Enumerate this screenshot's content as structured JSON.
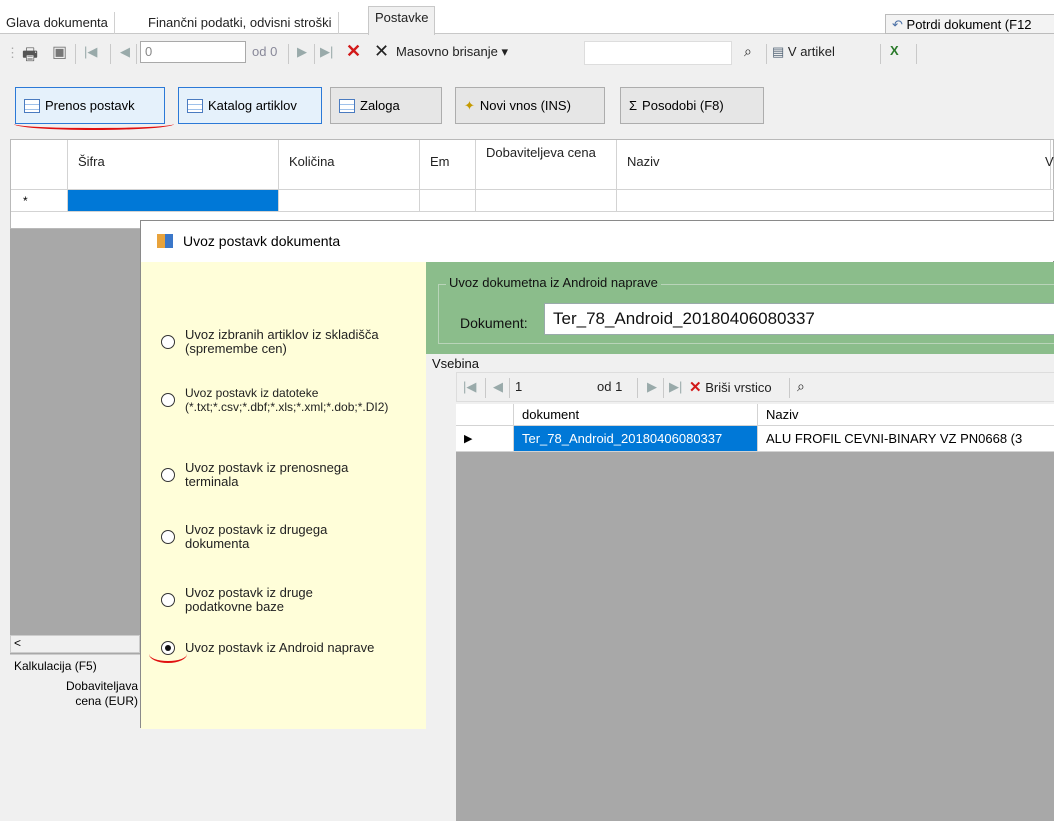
{
  "tabs": {
    "items": [
      "Glava dokumenta",
      "Finančni podatki, odvisni stroški",
      "Postavke"
    ],
    "confirm": "Potrdi dokument (F12"
  },
  "toolbar": {
    "page_value": "0",
    "of_label": "od 0",
    "delete_label": "Masovno brisanje",
    "article_label": "V artikel"
  },
  "buttons": {
    "transfer": "Prenos postavk",
    "catalog": "Katalog artiklov",
    "stock": "Zaloga",
    "new_entry": "Novi vnos (INS)",
    "update": "Posodobi (F8)"
  },
  "grid": {
    "headers": [
      "Šifra",
      "Količina",
      "Em",
      "Dobaviteljeva cena",
      "Naziv",
      "V"
    ],
    "row_marker": "*"
  },
  "modal": {
    "title": "Uvoz postavk dokumenta",
    "options": [
      {
        "label": "Uvoz izbranih artiklov iz skladišča (spremembe cen)",
        "checked": false
      },
      {
        "label": "Uvoz postavk iz datoteke (*.txt;*.csv;*.dbf;*.xls;*.xml;*.dob;*.DI2)",
        "checked": false
      },
      {
        "label": "Uvoz postavk iz prenosnega terminala",
        "checked": false
      },
      {
        "label": "Uvoz postavk iz drugega dokumenta",
        "checked": false
      },
      {
        "label": "Uvoz postavk iz druge podatkovne baze",
        "checked": false
      },
      {
        "label": "Uvoz postavk iz Android naprave",
        "checked": true
      }
    ],
    "group_label": "Uvoz dokumetna iz Android naprave",
    "doc_label": "Dokument:",
    "doc_value": "Ter_78_Android_20180406080337",
    "content_label": "Vsebina",
    "inner_toolbar": {
      "page_value": "1",
      "of_label": "od 1",
      "delete_row": "Briši vrstico"
    },
    "inner_grid": {
      "headers": [
        "dokument",
        "Naziv"
      ],
      "rows": [
        [
          "Ter_78_Android_20180406080337",
          "ALU FROFIL CEVNI-BINARY VZ PN0668 (3"
        ]
      ]
    }
  },
  "bottom": {
    "scroll_left": "<",
    "calc_tab": "Kalkulacija  (F5)",
    "supplier_price": "Dobaviteljava cena (EUR)"
  }
}
